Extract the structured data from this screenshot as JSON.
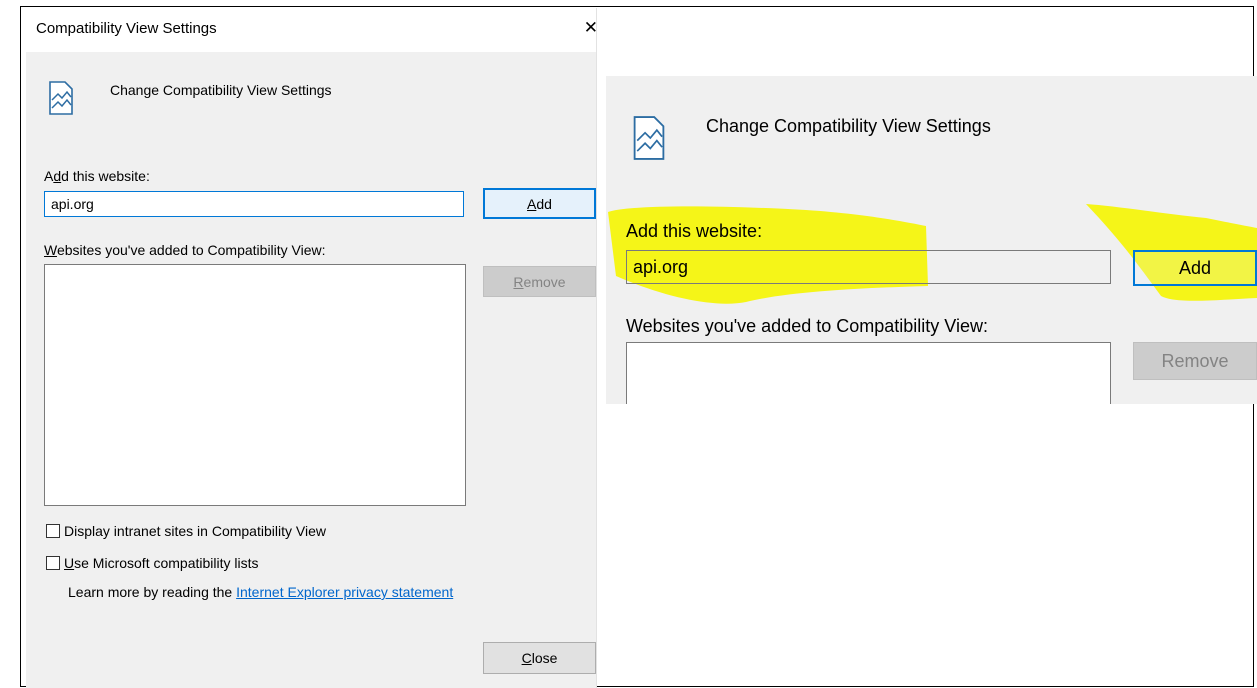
{
  "dialog": {
    "title": "Compatibility View Settings",
    "close_glyph": "✕",
    "heading": "Change Compatibility View Settings",
    "add_label_pre": "A",
    "add_label_ul": "d",
    "add_label_post": "d this website:",
    "website_input_value": "api.org",
    "add_button_ul": "A",
    "add_button_post": "dd",
    "list_label_ul": "W",
    "list_label_post": "ebsites you've added to Compatibility View:",
    "remove_button_ul": "R",
    "remove_button_post": "emove",
    "intranet_checkbox_label": "Display intranet sites in Compatibility View",
    "ms_lists_ul": "U",
    "ms_lists_post": "se Microsoft compatibility lists",
    "learn_more_text": "Learn more by reading the ",
    "privacy_link": "Internet Explorer privacy statement",
    "close_button_ul": "C",
    "close_button_post": "lose"
  },
  "zoom": {
    "heading": "Change Compatibility View Settings",
    "add_label": "Add this website:",
    "website_input_value": "api.org",
    "add_button": "Add",
    "list_label": "Websites you've added to Compatibility View:",
    "remove_button": "Remove",
    "highlight_color": "#f5f500"
  }
}
